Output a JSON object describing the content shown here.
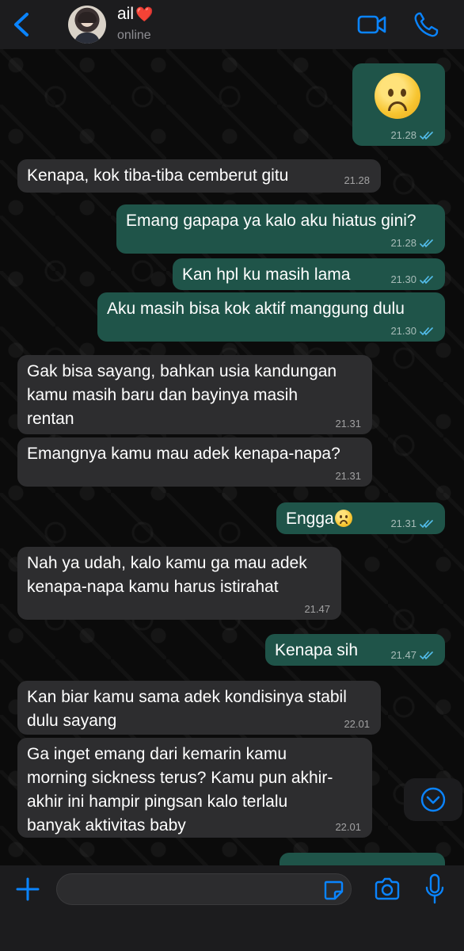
{
  "header": {
    "contact_name": "ail",
    "contact_emoji": "❤️",
    "status": "online"
  },
  "messages": [
    {
      "dir": "out",
      "text": "",
      "emoji": "sad-face",
      "time": "21.28"
    },
    {
      "dir": "in",
      "text": "Kenapa, kok tiba-tiba cemberut gitu",
      "time": "21.28"
    },
    {
      "dir": "out",
      "text": "Emang gapapa ya kalo aku hiatus gini?",
      "time": "21.28"
    },
    {
      "dir": "out",
      "text": "Kan hpl ku masih lama",
      "time": "21.30"
    },
    {
      "dir": "out",
      "text": "Aku masih bisa kok aktif manggung dulu",
      "time": "21.30"
    },
    {
      "dir": "in",
      "text": "Gak bisa sayang, bahkan usia kandungan\nkamu masih baru dan bayinya masih\nrentan",
      "time": "21.31"
    },
    {
      "dir": "in",
      "text": "Emangnya kamu mau adek kenapa-napa?",
      "time": "21.31"
    },
    {
      "dir": "out",
      "text": "Engga",
      "emoji": "sad-face-small",
      "time": "21.31"
    },
    {
      "dir": "in",
      "text": "Nah ya udah, kalo kamu ga mau adek\nkenapa-napa kamu harus istirahat",
      "time": "21.47"
    },
    {
      "dir": "out",
      "text": "Kenapa sih",
      "time": "21.47"
    },
    {
      "dir": "in",
      "text": "Kan biar kamu sama adek kondisinya stabil\ndulu sayang",
      "time": "22.01"
    },
    {
      "dir": "in",
      "text": "Ga inget emang dari kemarin kamu\nmorning sickness terus? Kamu pun akhir-\nakhir ini hampir pingsan kalo terlalu\nbanyak aktivitas baby",
      "time": "22.01"
    }
  ],
  "composer": {
    "value": "",
    "placeholder": ""
  },
  "colors": {
    "accent": "#0a84ff",
    "incoming_bubble": "#2d2d2f",
    "outgoing_bubble": "#1f5449",
    "read_ticks": "#53bdeb"
  },
  "icons": [
    "back-chevron-icon",
    "video-call-icon",
    "phone-icon",
    "scroll-down-icon",
    "plus-icon",
    "sticker-icon",
    "camera-icon",
    "microphone-icon"
  ]
}
